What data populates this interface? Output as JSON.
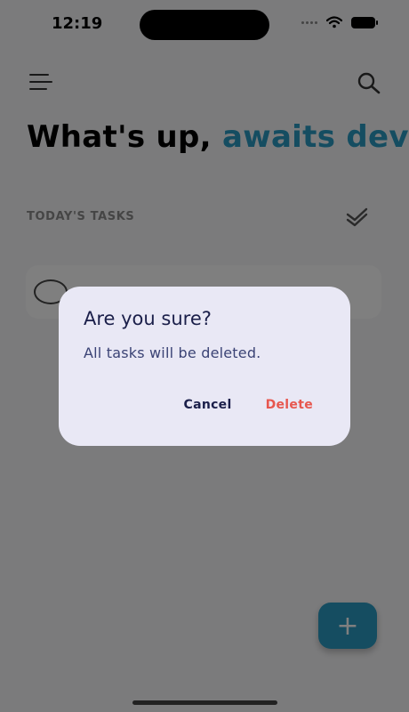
{
  "status_bar": {
    "time": "12:19"
  },
  "header": {
    "greeting_prefix": "What's up, ",
    "user_name": "awaits dev",
    "greeting_suffix": "!"
  },
  "tasks": {
    "section_title": "TODAY'S TASKS"
  },
  "fab": {
    "label": "+"
  },
  "dialog": {
    "title": "Are you sure?",
    "message": "All tasks will be deleted.",
    "cancel_label": "Cancel",
    "delete_label": "Delete"
  },
  "colors": {
    "accent": "#2a9bc2",
    "danger": "#e7574f",
    "dialog_background": "#e9e8f5",
    "dialog_title": "#1b1f4a"
  }
}
